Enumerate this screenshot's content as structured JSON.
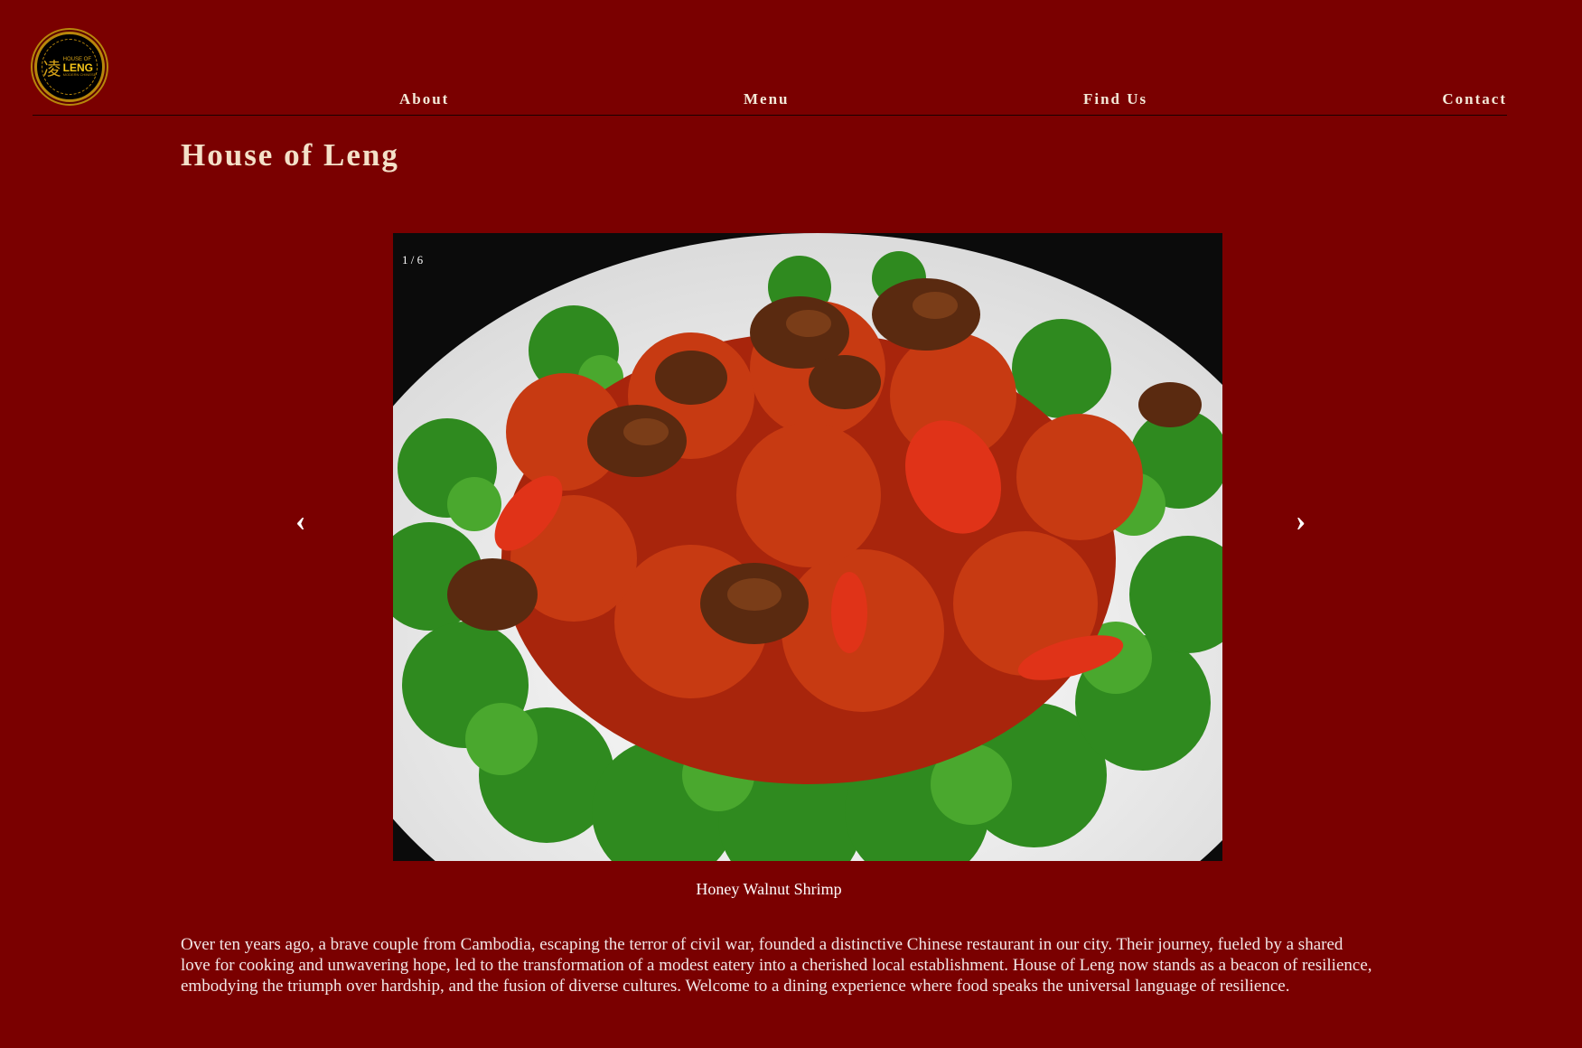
{
  "logo": {
    "char": "凌",
    "line1": "HOUSE OF",
    "line2": "LENG",
    "line3": "MODERN CHINESE"
  },
  "nav": {
    "about": "About",
    "menu": "Menu",
    "find_us": "Find Us",
    "contact": "Contact"
  },
  "page_title": "House of Leng",
  "slideshow": {
    "counter": "1 / 6",
    "prev": "‹",
    "next": "›",
    "caption": "Honey Walnut Shrimp"
  },
  "description": "Over ten years ago, a brave couple from Cambodia, escaping the terror of civil war, founded a distinctive Chinese restaurant in our city. Their journey, fueled by a shared love for cooking and unwavering hope, led to the transformation of a modest eatery into a cherished local establishment. House of Leng now stands as a beacon of resilience, embodying the triumph over hardship, and the fusion of diverse cultures. Welcome to a dining experience where food speaks the universal language of resilience.",
  "colors": {
    "background": "#7a0000",
    "title": "#f4e0c8",
    "gold": "#d4a017"
  }
}
